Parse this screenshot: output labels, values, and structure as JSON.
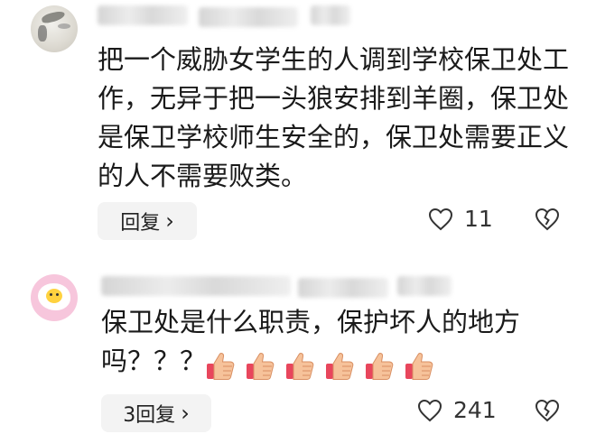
{
  "comments": [
    {
      "text": "把一个威胁女学生的人调到学校保卫处工作，无异于把一头狼安排到羊圈，保卫处是保卫学校师生安全的，保卫处需要正义的人不需要败类。",
      "reply_label": "回复",
      "like_count": "11",
      "icons": {
        "like": "heart-outline-icon",
        "dislike": "broken-heart-icon"
      }
    },
    {
      "text": "保卫处是什么职责，保护坏人的地方吗？？？",
      "reply_label": "3回复",
      "like_count": "241",
      "emoji": [
        "👍",
        "👍",
        "👍",
        "👍",
        "👍",
        "👍"
      ],
      "icons": {
        "like": "heart-outline-icon",
        "dislike": "broken-heart-icon"
      }
    }
  ],
  "colors": {
    "thumb_skin": "#f6c29a",
    "thumb_cuff": "#e8465c",
    "reply_bg": "#f3f3f3",
    "avatar2_bg": "#f7c6dc"
  }
}
